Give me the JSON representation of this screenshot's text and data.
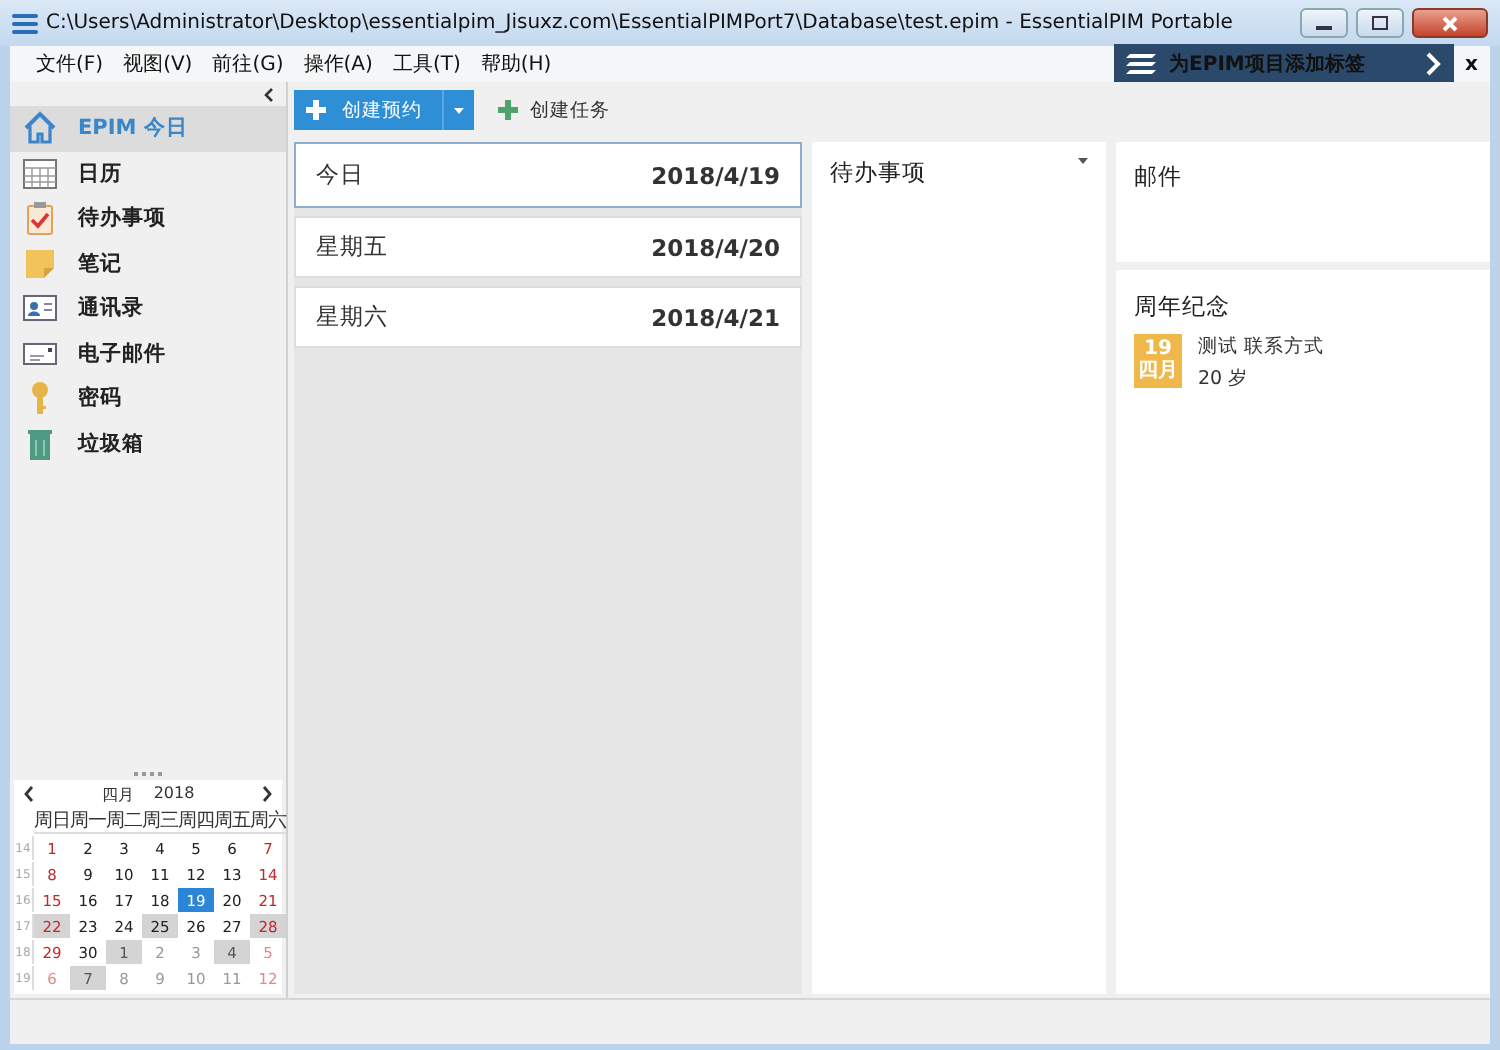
{
  "window": {
    "title": "C:\\Users\\Administrator\\Desktop\\essentialpim_Jisuxz.com\\EssentialPIMPort7\\Database\\test.epim - EssentialPIM Portable"
  },
  "menu": [
    {
      "label": "文件(F)"
    },
    {
      "label": "视图(V)"
    },
    {
      "label": "前往(G)"
    },
    {
      "label": "操作(A)"
    },
    {
      "label": "工具(T)"
    },
    {
      "label": "帮助(H)"
    }
  ],
  "tag_banner": {
    "text": "为EPIM项目添加标签",
    "close": "x"
  },
  "toolbar": {
    "new_appointment": "创建预约",
    "new_task": "创建任务"
  },
  "sidebar": {
    "items": [
      {
        "label": "EPIM 今日",
        "kind": "home",
        "selected": true
      },
      {
        "label": "日历",
        "kind": "calendar",
        "selected": false
      },
      {
        "label": "待办事项",
        "kind": "todo",
        "selected": false
      },
      {
        "label": "笔记",
        "kind": "note",
        "selected": false
      },
      {
        "label": "通讯录",
        "kind": "contacts",
        "selected": false
      },
      {
        "label": "电子邮件",
        "kind": "email",
        "selected": false
      },
      {
        "label": "密码",
        "kind": "password",
        "selected": false
      },
      {
        "label": "垃圾箱",
        "kind": "trash",
        "selected": false
      }
    ]
  },
  "mini_calendar": {
    "month": "四月",
    "year": "2018",
    "weekdays": [
      "周日",
      "周一",
      "周二",
      "周三",
      "周四",
      "周五",
      "周六"
    ],
    "weeks": [
      {
        "week": "14",
        "days": [
          {
            "d": "1",
            "weekend": true,
            "other_month": false,
            "has_items": false,
            "selected": false
          },
          {
            "d": "2",
            "weekend": false,
            "other_month": false,
            "has_items": false,
            "selected": false
          },
          {
            "d": "3",
            "weekend": false,
            "other_month": false,
            "has_items": false,
            "selected": false
          },
          {
            "d": "4",
            "weekend": false,
            "other_month": false,
            "has_items": false,
            "selected": false
          },
          {
            "d": "5",
            "weekend": false,
            "other_month": false,
            "has_items": false,
            "selected": false
          },
          {
            "d": "6",
            "weekend": false,
            "other_month": false,
            "has_items": false,
            "selected": false
          },
          {
            "d": "7",
            "weekend": true,
            "other_month": false,
            "has_items": false,
            "selected": false
          }
        ]
      },
      {
        "week": "15",
        "days": [
          {
            "d": "8",
            "weekend": true,
            "other_month": false,
            "has_items": false,
            "selected": false
          },
          {
            "d": "9",
            "weekend": false,
            "other_month": false,
            "has_items": false,
            "selected": false
          },
          {
            "d": "10",
            "weekend": false,
            "other_month": false,
            "has_items": false,
            "selected": false
          },
          {
            "d": "11",
            "weekend": false,
            "other_month": false,
            "has_items": false,
            "selected": false
          },
          {
            "d": "12",
            "weekend": false,
            "other_month": false,
            "has_items": false,
            "selected": false
          },
          {
            "d": "13",
            "weekend": false,
            "other_month": false,
            "has_items": false,
            "selected": false
          },
          {
            "d": "14",
            "weekend": true,
            "other_month": false,
            "has_items": false,
            "selected": false
          }
        ]
      },
      {
        "week": "16",
        "days": [
          {
            "d": "15",
            "weekend": true,
            "other_month": false,
            "has_items": false,
            "selected": false
          },
          {
            "d": "16",
            "weekend": false,
            "other_month": false,
            "has_items": false,
            "selected": false
          },
          {
            "d": "17",
            "weekend": false,
            "other_month": false,
            "has_items": false,
            "selected": false
          },
          {
            "d": "18",
            "weekend": false,
            "other_month": false,
            "has_items": false,
            "selected": false
          },
          {
            "d": "19",
            "weekend": false,
            "other_month": false,
            "has_items": false,
            "selected": true
          },
          {
            "d": "20",
            "weekend": false,
            "other_month": false,
            "has_items": false,
            "selected": false
          },
          {
            "d": "21",
            "weekend": true,
            "other_month": false,
            "has_items": false,
            "selected": false
          }
        ]
      },
      {
        "week": "17",
        "days": [
          {
            "d": "22",
            "weekend": true,
            "other_month": false,
            "has_items": true,
            "selected": false
          },
          {
            "d": "23",
            "weekend": false,
            "other_month": false,
            "has_items": false,
            "selected": false
          },
          {
            "d": "24",
            "weekend": false,
            "other_month": false,
            "has_items": false,
            "selected": false
          },
          {
            "d": "25",
            "weekend": false,
            "other_month": false,
            "has_items": true,
            "selected": false
          },
          {
            "d": "26",
            "weekend": false,
            "other_month": false,
            "has_items": false,
            "selected": false
          },
          {
            "d": "27",
            "weekend": false,
            "other_month": false,
            "has_items": false,
            "selected": false
          },
          {
            "d": "28",
            "weekend": true,
            "other_month": false,
            "has_items": true,
            "selected": false
          }
        ]
      },
      {
        "week": "18",
        "days": [
          {
            "d": "29",
            "weekend": true,
            "other_month": false,
            "has_items": false,
            "selected": false
          },
          {
            "d": "30",
            "weekend": false,
            "other_month": false,
            "has_items": false,
            "selected": false
          },
          {
            "d": "1",
            "weekend": false,
            "other_month": true,
            "has_items": true,
            "selected": false
          },
          {
            "d": "2",
            "weekend": false,
            "other_month": true,
            "has_items": false,
            "selected": false
          },
          {
            "d": "3",
            "weekend": false,
            "other_month": true,
            "has_items": false,
            "selected": false
          },
          {
            "d": "4",
            "weekend": false,
            "other_month": true,
            "has_items": true,
            "selected": false
          },
          {
            "d": "5",
            "weekend": true,
            "other_month": true,
            "has_items": false,
            "selected": false
          }
        ]
      },
      {
        "week": "19",
        "days": [
          {
            "d": "6",
            "weekend": true,
            "other_month": true,
            "has_items": false,
            "selected": false
          },
          {
            "d": "7",
            "weekend": false,
            "other_month": true,
            "has_items": true,
            "selected": false
          },
          {
            "d": "8",
            "weekend": false,
            "other_month": true,
            "has_items": false,
            "selected": false
          },
          {
            "d": "9",
            "weekend": false,
            "other_month": true,
            "has_items": false,
            "selected": false
          },
          {
            "d": "10",
            "weekend": false,
            "other_month": true,
            "has_items": false,
            "selected": false
          },
          {
            "d": "11",
            "weekend": false,
            "other_month": true,
            "has_items": false,
            "selected": false
          },
          {
            "d": "12",
            "weekend": true,
            "other_month": true,
            "has_items": false,
            "selected": false
          }
        ]
      }
    ]
  },
  "today": {
    "days": [
      {
        "name": "今日",
        "date": "2018/4/19",
        "selected": true
      },
      {
        "name": "星期五",
        "date": "2018/4/20",
        "selected": false
      },
      {
        "name": "星期六",
        "date": "2018/4/21",
        "selected": false
      }
    ]
  },
  "todo": {
    "title": "待办事项"
  },
  "mail": {
    "title": "邮件"
  },
  "anniversaries": {
    "title": "周年纪念",
    "items": [
      {
        "day": "19",
        "month": "四月",
        "name": "测试 联系方式",
        "age": "20 岁"
      }
    ]
  }
}
